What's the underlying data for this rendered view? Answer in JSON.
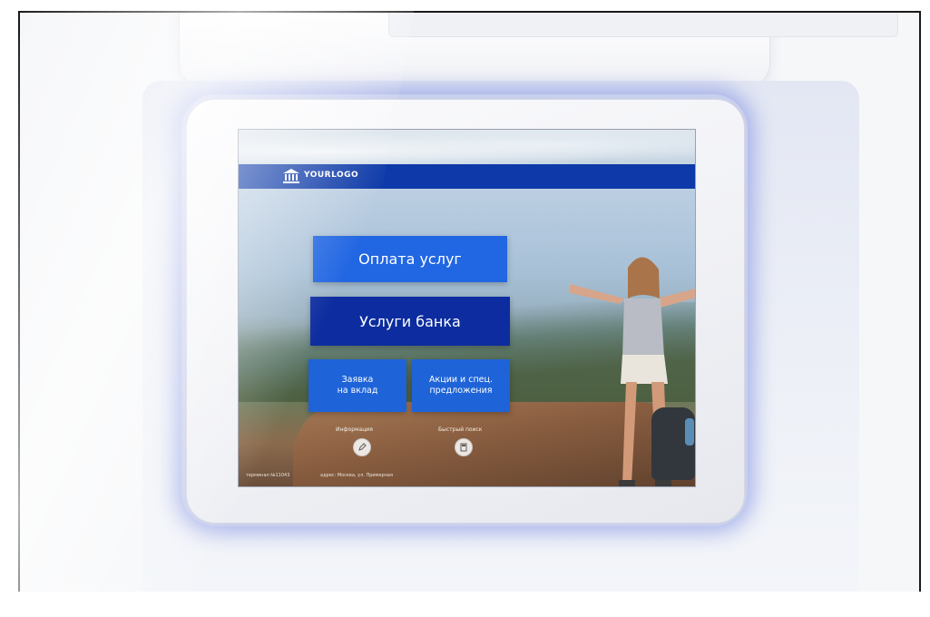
{
  "header": {
    "logo_text": "YOURLOGO"
  },
  "buttons": {
    "pay_services": "Оплата услуг",
    "bank_services": "Услуги банка",
    "deposit_request": "Заявка\nна вклад",
    "promotions": "Акции и спец.\nпредложения"
  },
  "shortcuts": {
    "information": "Информация",
    "quick_payment": "Быстрый поиск"
  },
  "footer": {
    "terminal_label": "терминал №11043",
    "address_label": "адрес: Москва, ул. Примерная"
  },
  "colors": {
    "header_blue": "#0d3aa8",
    "pay_button": "#2166e2",
    "bank_button": "#0c2c9f",
    "small_button": "#1e63d8"
  },
  "icons": {
    "logo": "bank-building-icon",
    "information": "pencil-icon",
    "quick_payment": "calculator-icon"
  }
}
